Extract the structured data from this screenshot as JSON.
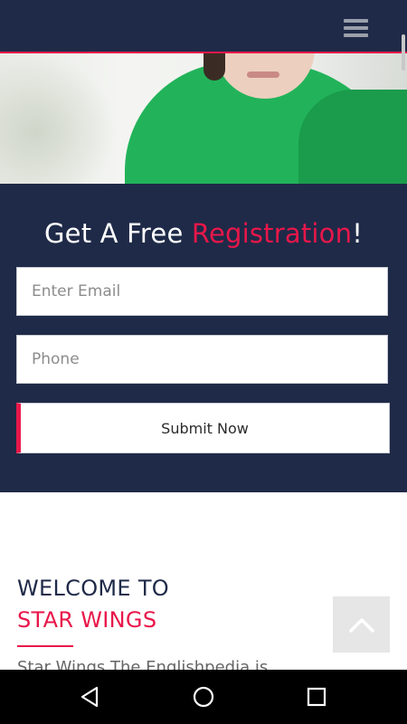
{
  "header": {
    "menu_icon": "hamburger-menu-icon"
  },
  "registration": {
    "title_prefix": "Get A Free ",
    "title_accent": "Registration",
    "title_suffix": "!",
    "email_placeholder": "Enter Email",
    "email_value": "",
    "phone_placeholder": "Phone",
    "phone_value": "",
    "submit_label": "Submit Now"
  },
  "welcome": {
    "line1": "WELCOME TO",
    "line2": "STAR WINGS",
    "body_text": "Star Wings The Englishpedia is"
  },
  "back_to_top": {
    "icon": "chevron-up-icon"
  },
  "system_nav": {
    "back_icon": "back-triangle-icon",
    "home_icon": "home-circle-icon",
    "recents_icon": "recents-square-icon"
  },
  "colors": {
    "navy": "#1f2a48",
    "accent": "#e8174a",
    "white": "#ffffff"
  }
}
